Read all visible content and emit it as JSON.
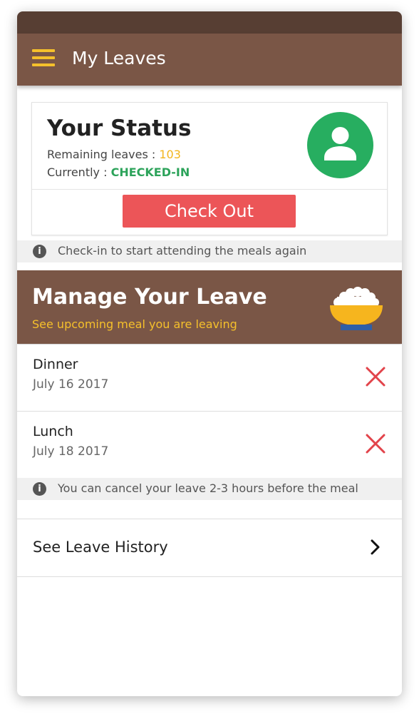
{
  "app": {
    "title": "My Leaves"
  },
  "status_card": {
    "title": "Your Status",
    "remaining_label": "Remaining leaves : ",
    "remaining_value": "103",
    "current_label": "Currently : ",
    "current_value": "CHECKED-IN",
    "checkout_label": "Check Out"
  },
  "info_checkin": "Check-in to start attending the meals again",
  "manage": {
    "title": "Manage Your Leave",
    "subtitle": "See upcoming meal you are leaving"
  },
  "meals": [
    {
      "name": "Dinner",
      "date": "July 16 2017"
    },
    {
      "name": "Lunch",
      "date": "July 18 2017"
    }
  ],
  "info_cancel": "You can cancel your leave 2-3 hours before the meal",
  "history_label": "See Leave History",
  "icons": {
    "menu": "hamburger-icon",
    "avatar": "user-icon",
    "info": "info-icon",
    "meal": "rice-bowl-icon",
    "cancel": "close-icon",
    "chevron": "chevron-right-icon"
  },
  "colors": {
    "brown": "#7a5646",
    "brown_dark": "#573e33",
    "accent_yellow": "#f5c02b",
    "green": "#27ae60",
    "red": "#ec5558"
  }
}
